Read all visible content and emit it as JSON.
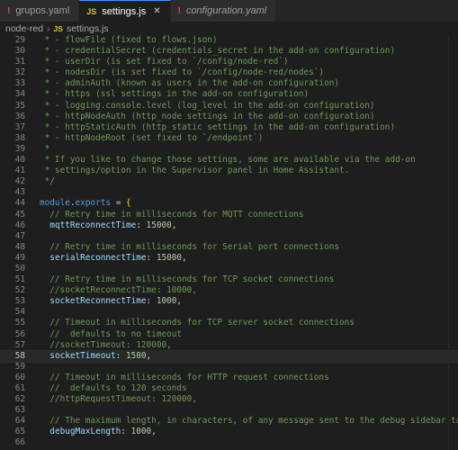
{
  "tabs": [
    {
      "label": "grupos.yaml",
      "icon": "yaml-icon",
      "active": false
    },
    {
      "label": "settings.js",
      "icon": "js-icon",
      "active": true
    },
    {
      "label": "configuration.yaml",
      "icon": "yaml-icon",
      "active": false
    }
  ],
  "breadcrumbs": {
    "folder": "node-red",
    "file": "settings.js"
  },
  "current_line": 58,
  "lines": [
    {
      "n": "29",
      "t": " * - flowFile (fixed to flows.json)",
      "cls": "c"
    },
    {
      "n": "30",
      "t": " * - credentialSecret (credentials_secret in the add-on configuration)",
      "cls": "c"
    },
    {
      "n": "31",
      "t": " * - userDir (is set fixed to `/config/node-red`)",
      "cls": "c"
    },
    {
      "n": "32",
      "t": " * - nodesDir (is set fixed to `/config/node-red/nodes`)",
      "cls": "c"
    },
    {
      "n": "33",
      "t": " * - adminAuth (known as users in the add-on configuration)",
      "cls": "c"
    },
    {
      "n": "34",
      "t": " * - https (ssl settings in the add-on configuration)",
      "cls": "c"
    },
    {
      "n": "35",
      "t": " * - logging.console.level (log_level in the add-on configuration)",
      "cls": "c"
    },
    {
      "n": "36",
      "t": " * - httpNodeAuth (http_node settings in the add-on configuration)",
      "cls": "c"
    },
    {
      "n": "37",
      "t": " * - httpStaticAuth (http_static settings in the add-on configuration)",
      "cls": "c"
    },
    {
      "n": "38",
      "t": " * - httpNodeRoot (set fixed to `/endpoint`)",
      "cls": "c"
    },
    {
      "n": "39",
      "t": " *",
      "cls": "c"
    },
    {
      "n": "40",
      "t": " * If you like to change those settings, some are available via the add-on",
      "cls": "c"
    },
    {
      "n": "41",
      "t": " * settings/option in the Supervisor panel in Home Assistant.",
      "cls": "c"
    },
    {
      "n": "42",
      "t": " */",
      "cls": "c"
    },
    {
      "n": "43",
      "t": "",
      "cls": ""
    },
    {
      "n": "44",
      "t": "module.exports = {",
      "cls": "mod"
    },
    {
      "n": "45",
      "t": "  // Retry time in milliseconds for MQTT connections",
      "cls": "c"
    },
    {
      "n": "46",
      "t": "  mqttReconnectTime: 15000,",
      "cls": "prop",
      "key": "mqttReconnectTime",
      "val": "15000"
    },
    {
      "n": "47",
      "t": "",
      "cls": ""
    },
    {
      "n": "48",
      "t": "  // Retry time in milliseconds for Serial port connections",
      "cls": "c"
    },
    {
      "n": "49",
      "t": "  serialReconnectTime: 15000,",
      "cls": "prop",
      "key": "serialReconnectTime",
      "val": "15000"
    },
    {
      "n": "50",
      "t": "",
      "cls": ""
    },
    {
      "n": "51",
      "t": "  // Retry time in milliseconds for TCP socket connections",
      "cls": "c"
    },
    {
      "n": "52",
      "t": "  //socketReconnectTime: 10000,",
      "cls": "c"
    },
    {
      "n": "53",
      "t": "  socketReconnectTime: 1000,",
      "cls": "prop",
      "key": "socketReconnectTime",
      "val": "1000"
    },
    {
      "n": "54",
      "t": "",
      "cls": ""
    },
    {
      "n": "55",
      "t": "  // Timeout in milliseconds for TCP server socket connections",
      "cls": "c"
    },
    {
      "n": "56",
      "t": "  //  defaults to no timeout",
      "cls": "c"
    },
    {
      "n": "57",
      "t": "  //socketTimeout: 120000,",
      "cls": "c"
    },
    {
      "n": "58",
      "t": "  socketTimeout: 1500,",
      "cls": "prop",
      "key": "socketTimeout",
      "val": "1500"
    },
    {
      "n": "59",
      "t": "",
      "cls": ""
    },
    {
      "n": "60",
      "t": "  // Timeout in milliseconds for HTTP request connections",
      "cls": "c"
    },
    {
      "n": "61",
      "t": "  //  defaults to 120 seconds",
      "cls": "c"
    },
    {
      "n": "62",
      "t": "  //httpRequestTimeout: 120000,",
      "cls": "c"
    },
    {
      "n": "63",
      "t": "",
      "cls": ""
    },
    {
      "n": "64",
      "t": "  // The maximum length, in characters, of any message sent to the debug sidebar tab",
      "cls": "c"
    },
    {
      "n": "65",
      "t": "  debugMaxLength: 1000,",
      "cls": "prop",
      "key": "debugMaxLength",
      "val": "1000"
    },
    {
      "n": "66",
      "t": "",
      "cls": ""
    }
  ]
}
